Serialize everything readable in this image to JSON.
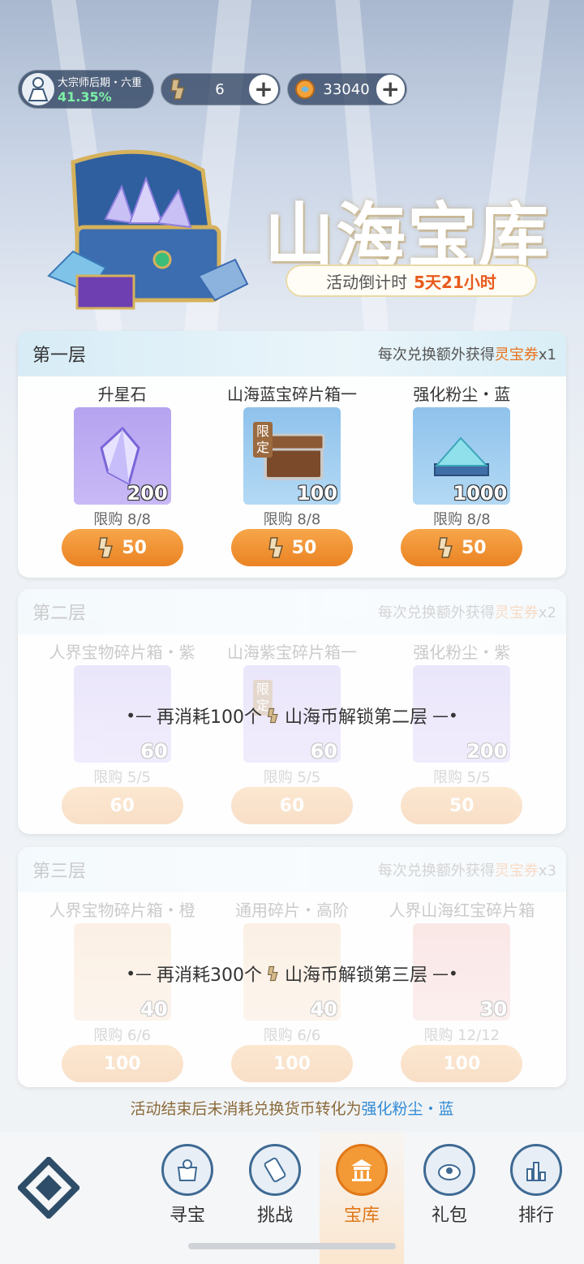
{
  "top_bar": {
    "rank_title": "大宗师后期・六重",
    "rank_progress": "41.35%",
    "currency1_value": "6",
    "currency2_value": "33040"
  },
  "hero": {
    "title": "山海宝库",
    "countdown_label": "活动倒计时",
    "countdown_value": "5天21小时"
  },
  "tiers": [
    {
      "name": "第一层",
      "bonus_prefix": "每次兑换额外获得",
      "bonus_item": "灵宝券",
      "bonus_suffix": "x1",
      "locked": false,
      "items": [
        {
          "name": "升星石",
          "qty": "200",
          "limit": "限购 8/8",
          "price": "50"
        },
        {
          "name": "山海蓝宝碎片箱一",
          "qty": "100",
          "limit": "限购 8/8",
          "price": "50",
          "tag": "限定"
        },
        {
          "name": "强化粉尘・蓝",
          "qty": "1000",
          "limit": "限购 8/8",
          "price": "50"
        }
      ]
    },
    {
      "name": "第二层",
      "bonus_prefix": "每次兑换额外获得",
      "bonus_item": "灵宝券",
      "bonus_suffix": "x2",
      "locked": true,
      "unlock_prefix": "再消耗100个",
      "unlock_suffix": "山海币解锁第二层",
      "items": [
        {
          "name": "人界宝物碎片箱・紫",
          "qty": "60",
          "limit": "限购 5/5",
          "price": "60"
        },
        {
          "name": "山海紫宝碎片箱一",
          "qty": "60",
          "limit": "限购 5/5",
          "price": "60",
          "tag": "限定"
        },
        {
          "name": "强化粉尘・紫",
          "qty": "200",
          "limit": "限购 5/5",
          "price": "50"
        }
      ]
    },
    {
      "name": "第三层",
      "bonus_prefix": "每次兑换额外获得",
      "bonus_item": "灵宝券",
      "bonus_suffix": "x3",
      "locked": true,
      "unlock_prefix": "再消耗300个",
      "unlock_suffix": "山海币解锁第三层",
      "items": [
        {
          "name": "人界宝物碎片箱・橙",
          "qty": "40",
          "limit": "限购 6/6",
          "price": "100"
        },
        {
          "name": "通用碎片・高阶",
          "qty": "40",
          "limit": "限购 6/6",
          "price": "100"
        },
        {
          "name": "人界山海红宝碎片箱",
          "qty": "30",
          "limit": "限购 12/12",
          "price": "100"
        }
      ]
    }
  ],
  "footnote": {
    "prefix": "活动结束后未消耗兑换货币转化为",
    "highlight": "强化粉尘・蓝"
  },
  "nav": {
    "items": [
      "寻宝",
      "挑战",
      "宝库",
      "礼包",
      "排行"
    ],
    "active": "宝库"
  }
}
